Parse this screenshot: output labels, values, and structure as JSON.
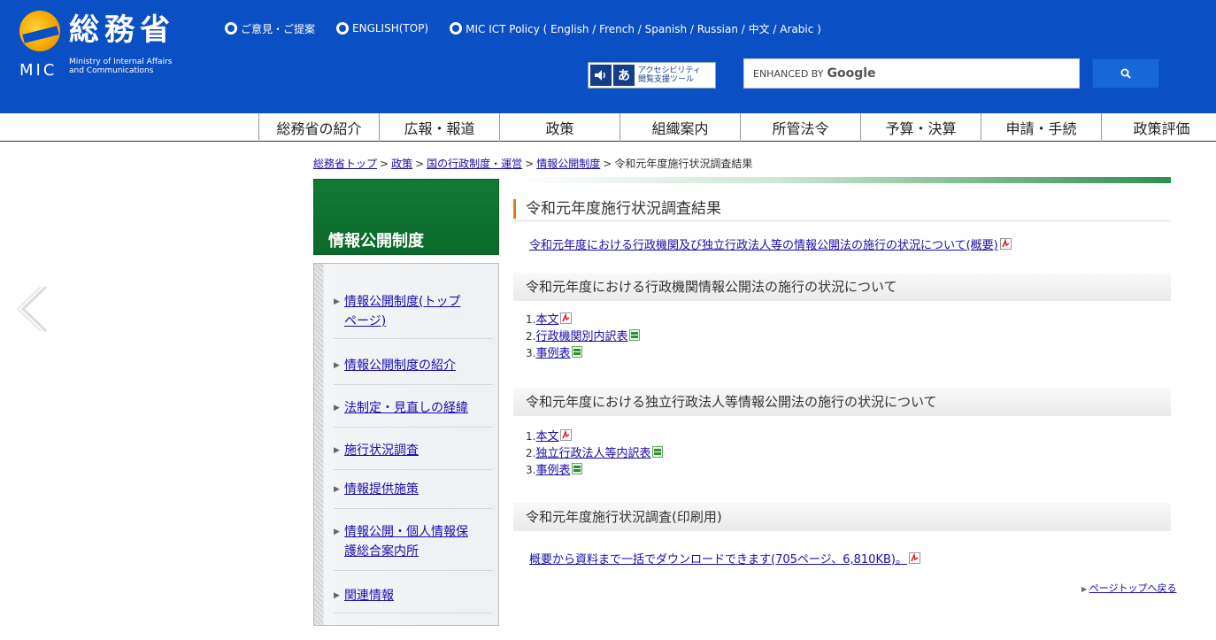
{
  "header": {
    "logo_kanji": "総務省",
    "logo_abbr": "MIC",
    "ministry_en_line1": "Ministry of Internal Affairs",
    "ministry_en_line2": "and Communications",
    "top_links": [
      "ご意見・ご提案",
      "ENGLISH(TOP)",
      "MIC ICT Policy ( English / French / Spanish / Russian / 中文 / Arabic )"
    ],
    "accessibility_label_line1": "アクセシビリティ",
    "accessibility_label_line2": "閲覧支援ツール",
    "accessibility_a": "あ",
    "search_enhanced": "ENHANCED BY",
    "search_brand": "Google",
    "colors": {
      "header_bg": "#0a4fc4",
      "search_button": "#1767d8"
    }
  },
  "nav": [
    "総務省の紹介",
    "広報・報道",
    "政策",
    "組織案内",
    "所管法令",
    "予算・決算",
    "申請・手続",
    "政策評価"
  ],
  "breadcrumb": {
    "items": [
      "総務省トップ",
      "政策",
      "国の行政制度・運営",
      "情報公開制度"
    ],
    "current": "令和元年度施行状況調査結果",
    "separator": ">"
  },
  "sidebar": {
    "title": "情報公開制度",
    "items": [
      {
        "label_line1": "情報公開制度(トップ",
        "label_line2": "ページ)"
      },
      {
        "label_line1": "情報公開制度の紹介",
        "label_line2": ""
      },
      {
        "label_line1": "法制定・見直しの経緯",
        "label_line2": ""
      },
      {
        "label_line1": "施行状況調査",
        "label_line2": ""
      },
      {
        "label_line1": "情報提供施策",
        "label_line2": ""
      },
      {
        "label_line1": "情報公開・個人情報保",
        "label_line2": "護総合案内所"
      },
      {
        "label_line1": "関連情報",
        "label_line2": ""
      }
    ]
  },
  "main": {
    "title": "令和元年度施行状況調査結果",
    "summary_link": "令和元年度における行政機関及び独立行政法人等の情報公開法の施行の状況について(概要)",
    "sections": [
      {
        "heading": "令和元年度における行政機関情報公開法の施行の状況について",
        "items": [
          {
            "num": "1.",
            "label": "本文",
            "icon": "pdf-icon"
          },
          {
            "num": "2.",
            "label": "行政機関別内訳表",
            "icon": "excel-icon"
          },
          {
            "num": "3.",
            "label": "事例表",
            "icon": "excel-icon"
          }
        ]
      },
      {
        "heading": "令和元年度における独立行政法人等情報公開法の施行の状況について",
        "items": [
          {
            "num": "1.",
            "label": "本文",
            "icon": "pdf-icon"
          },
          {
            "num": "2.",
            "label": "独立行政法人等内訳表",
            "icon": "excel-icon"
          },
          {
            "num": "3.",
            "label": "事例表",
            "icon": "excel-icon"
          }
        ]
      },
      {
        "heading": "令和元年度施行状況調査(印刷用)",
        "items": []
      }
    ],
    "print_link": "概要から資料まで一括でダウンロードできます(705ページ、6,810KB)。",
    "page_top": "ページトップへ戻る"
  }
}
